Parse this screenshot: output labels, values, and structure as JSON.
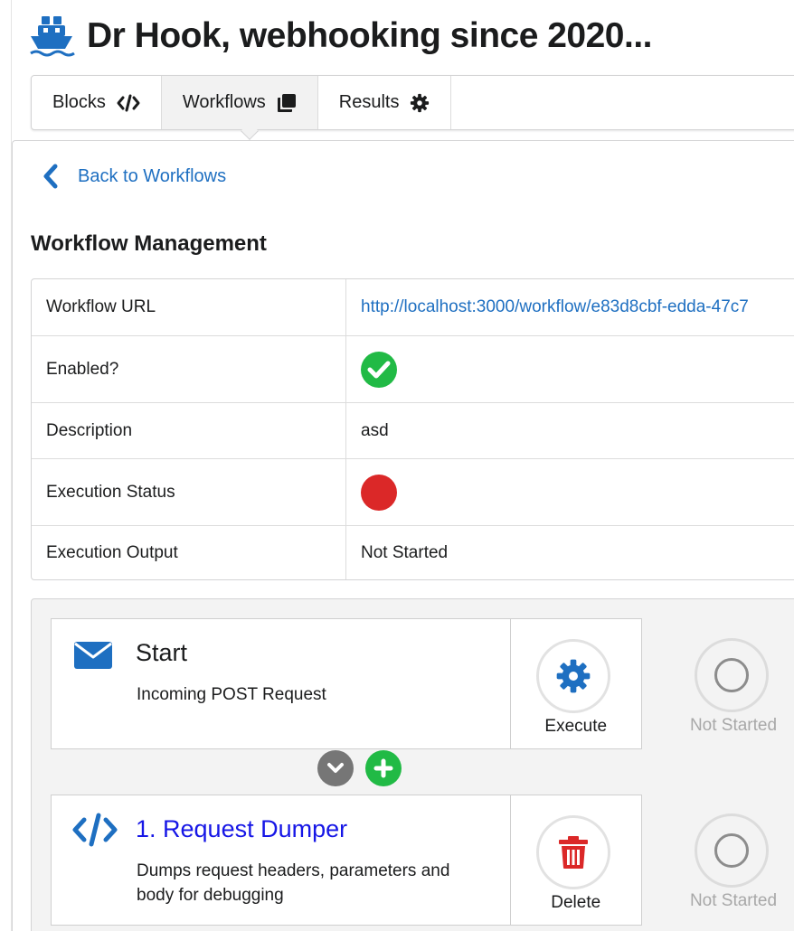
{
  "header": {
    "title": "Dr Hook, webhooking since 2020...",
    "logo_icon": "ship-icon"
  },
  "menu": {
    "items": [
      {
        "label": "Blocks",
        "icon": "code-icon"
      },
      {
        "label": "Workflows",
        "icon": "clone-icon",
        "active": true
      },
      {
        "label": "Results",
        "icon": "gear-icon"
      }
    ]
  },
  "back_link": {
    "label": "Back to Workflows"
  },
  "management": {
    "title": "Workflow Management",
    "rows": [
      {
        "key": "Workflow URL",
        "value": "http://localhost:3000/workflow/e83d8cbf-edda-47c7"
      },
      {
        "key": "Enabled?",
        "value_icon": "check-circle-icon"
      },
      {
        "key": "Description",
        "value": "asd"
      },
      {
        "key": "Execution Status",
        "value_icon": "red-status-dot"
      },
      {
        "key": "Execution Output",
        "value": "Not Started"
      }
    ]
  },
  "workflow": {
    "blocks": [
      {
        "icon": "envelope-icon",
        "name": "Start",
        "description": "Incoming POST Request",
        "action": {
          "label": "Execute",
          "icon": "gear-icon"
        },
        "status": "Not Started"
      },
      {
        "icon": "code-icon",
        "name": "1. Request Dumper",
        "description": "Dumps request headers, parameters and body for debugging",
        "action": {
          "label": "Delete",
          "icon": "trash-icon"
        },
        "status": "Not Started"
      }
    ],
    "connector": {
      "collapse_icon": "chevron-down-icon",
      "add_icon": "plus-icon"
    }
  },
  "colors": {
    "link": "#1e6fc1",
    "block_link": "#1616e6",
    "success": "#21ba45",
    "danger": "#db2828",
    "muted": "#a8a8a8"
  }
}
